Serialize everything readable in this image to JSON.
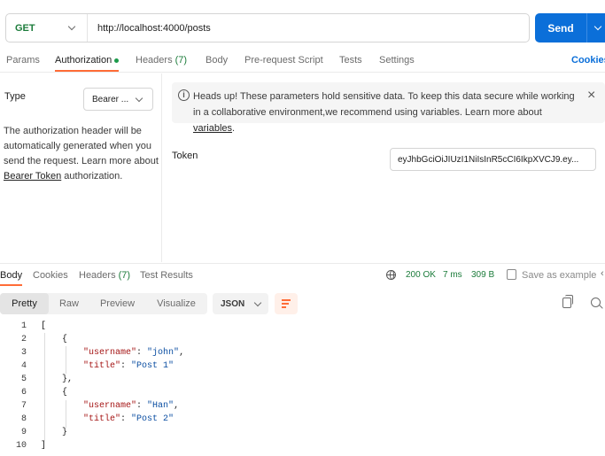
{
  "request": {
    "method": "GET",
    "url": "http://localhost:4000/posts",
    "send_label": "Send",
    "tabs": [
      {
        "label": "Params",
        "active": false
      },
      {
        "label": "Authorization",
        "active": true,
        "dot": true
      },
      {
        "label": "Headers",
        "count": "(7)",
        "active": false
      },
      {
        "label": "Body",
        "active": false
      },
      {
        "label": "Pre-request Script",
        "active": false
      },
      {
        "label": "Tests",
        "active": false
      },
      {
        "label": "Settings",
        "active": false
      }
    ],
    "cookies_link": "Cookies"
  },
  "auth": {
    "type_label": "Type",
    "type_value": "Bearer ...",
    "description": "The authorization header will be automatically generated when you send the request. Learn more about",
    "description_link": "Bearer Token",
    "description_tail": "authorization.",
    "alert_text": "Heads up! These parameters hold sensitive data. To keep this data secure while working in a collaborative environment,we recommend using variables. Learn more about",
    "alert_link": "variables",
    "alert_tail": ".",
    "token_label": "Token",
    "token_value": "eyJhbGciOiJIUzI1NiIsInR5cCI6IkpXVCJ9.ey..."
  },
  "response": {
    "tabs": [
      {
        "label": "Body",
        "active": true
      },
      {
        "label": "Cookies",
        "active": false
      },
      {
        "label": "Headers",
        "count": "(7)",
        "active": false
      },
      {
        "label": "Test Results",
        "active": false
      }
    ],
    "status": "200 OK",
    "time": "7 ms",
    "size": "309 B",
    "save_label": "Save as example",
    "view_modes": [
      "Pretty",
      "Raw",
      "Preview",
      "Visualize"
    ],
    "active_view": "Pretty",
    "format": "JSON",
    "lines": [
      {
        "n": "1",
        "text": "["
      },
      {
        "n": "2",
        "text": "    {"
      },
      {
        "n": "3",
        "indent": "        ",
        "key": "\"username\"",
        "sep": ": ",
        "val": "\"john\"",
        "end": ","
      },
      {
        "n": "4",
        "indent": "        ",
        "key": "\"title\"",
        "sep": ": ",
        "val": "\"Post 1\"",
        "end": ""
      },
      {
        "n": "5",
        "text": "    },"
      },
      {
        "n": "6",
        "text": "    {"
      },
      {
        "n": "7",
        "indent": "        ",
        "key": "\"username\"",
        "sep": ": ",
        "val": "\"Han\"",
        "end": ","
      },
      {
        "n": "8",
        "indent": "        ",
        "key": "\"title\"",
        "sep": ": ",
        "val": "\"Post 2\"",
        "end": ""
      },
      {
        "n": "9",
        "text": "    }"
      },
      {
        "n": "10",
        "text": "]"
      }
    ]
  },
  "colors": {
    "accent": "#ff6c37",
    "send": "#0b6fd9",
    "status_ok": "#1c7c3b"
  }
}
